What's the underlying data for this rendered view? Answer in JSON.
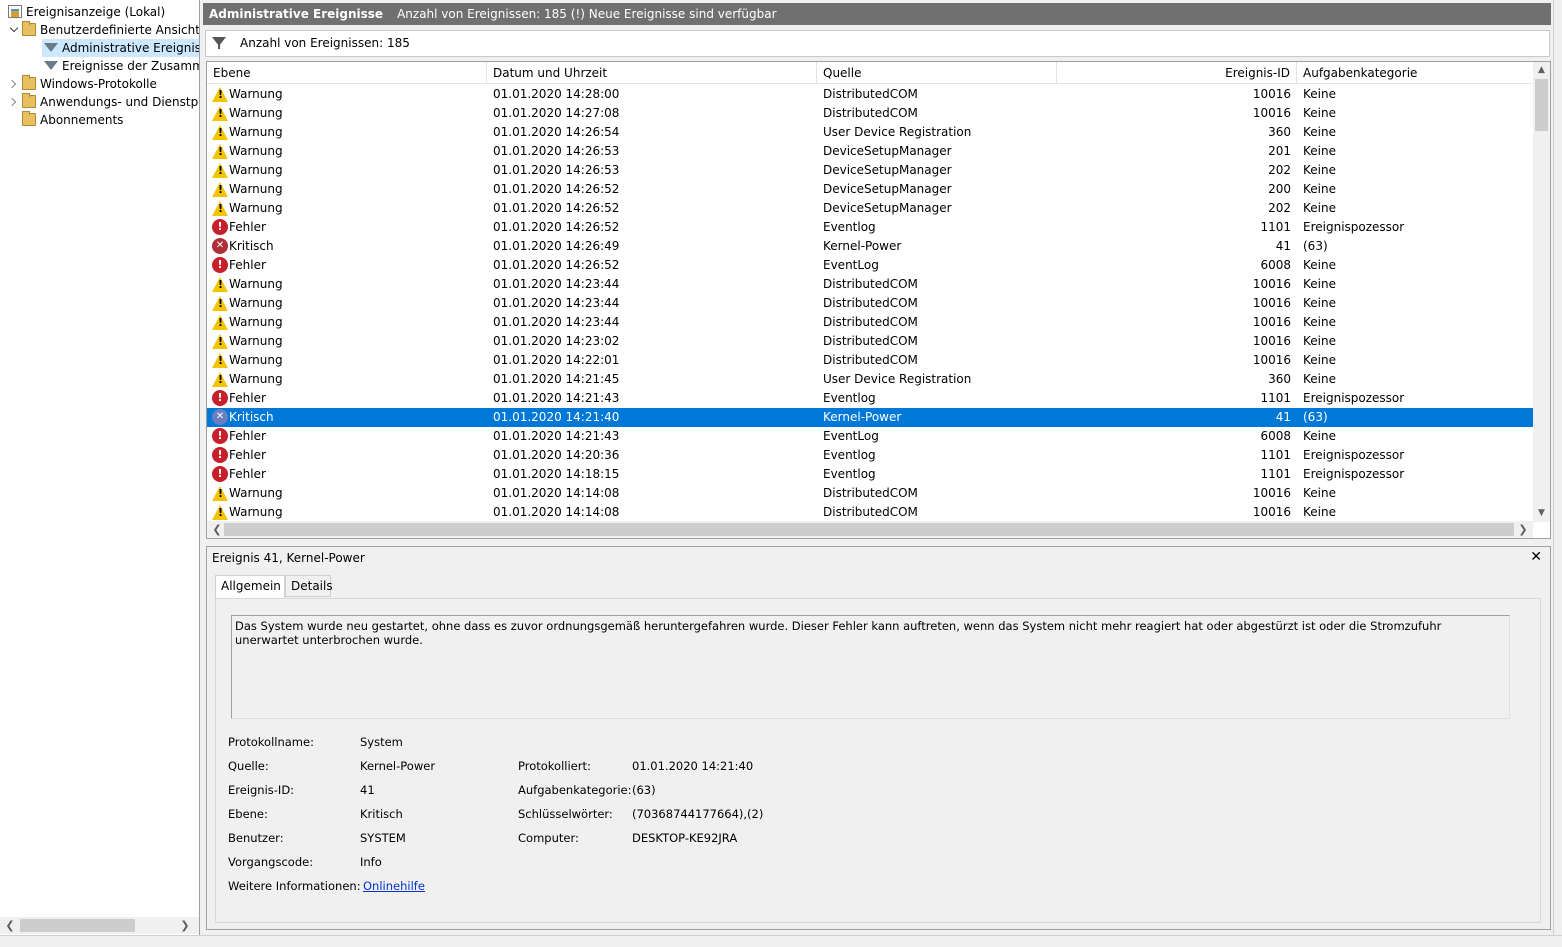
{
  "tree": {
    "items": [
      {
        "label": "Ereignisanzeige (Lokal)",
        "icon": "event-viewer-icon"
      },
      {
        "label": "Benutzerdefinierte Ansichten",
        "icon": "folder-icon"
      },
      {
        "label": "Administrative Ereignisse",
        "icon": "filter-icon"
      },
      {
        "label": "Ereignisse der Zusammenfassung",
        "icon": "filter-icon"
      },
      {
        "label": "Windows-Protokolle",
        "icon": "folder-icon"
      },
      {
        "label": "Anwendungs- und Dienstprotokolle",
        "icon": "folder-icon"
      },
      {
        "label": "Abonnements",
        "icon": "folder-icon"
      }
    ]
  },
  "header": {
    "title": "Administrative Ereignisse",
    "subtitle": "Anzahl von Ereignissen: 185 (!) Neue Ereignisse sind verfügbar"
  },
  "filter": {
    "text": "Anzahl von Ereignissen: 185"
  },
  "grid": {
    "columns": [
      "Ebene",
      "Datum und Uhrzeit",
      "Quelle",
      "Ereignis-ID",
      "Aufgabenkategorie"
    ],
    "rows": [
      {
        "level": "Warnung",
        "type": "warn",
        "date": "01.01.2020 14:28:00",
        "source": "DistributedCOM",
        "id": "10016",
        "cat": "Keine"
      },
      {
        "level": "Warnung",
        "type": "warn",
        "date": "01.01.2020 14:27:08",
        "source": "DistributedCOM",
        "id": "10016",
        "cat": "Keine"
      },
      {
        "level": "Warnung",
        "type": "warn",
        "date": "01.01.2020 14:26:54",
        "source": "User Device Registration",
        "id": "360",
        "cat": "Keine"
      },
      {
        "level": "Warnung",
        "type": "warn",
        "date": "01.01.2020 14:26:53",
        "source": "DeviceSetupManager",
        "id": "201",
        "cat": "Keine"
      },
      {
        "level": "Warnung",
        "type": "warn",
        "date": "01.01.2020 14:26:53",
        "source": "DeviceSetupManager",
        "id": "202",
        "cat": "Keine"
      },
      {
        "level": "Warnung",
        "type": "warn",
        "date": "01.01.2020 14:26:52",
        "source": "DeviceSetupManager",
        "id": "200",
        "cat": "Keine"
      },
      {
        "level": "Warnung",
        "type": "warn",
        "date": "01.01.2020 14:26:52",
        "source": "DeviceSetupManager",
        "id": "202",
        "cat": "Keine"
      },
      {
        "level": "Fehler",
        "type": "err",
        "date": "01.01.2020 14:26:52",
        "source": "Eventlog",
        "id": "1101",
        "cat": "Ereignispozessor"
      },
      {
        "level": "Kritisch",
        "type": "crit",
        "date": "01.01.2020 14:26:49",
        "source": "Kernel-Power",
        "id": "41",
        "cat": "(63)"
      },
      {
        "level": "Fehler",
        "type": "err",
        "date": "01.01.2020 14:26:52",
        "source": "EventLog",
        "id": "6008",
        "cat": "Keine"
      },
      {
        "level": "Warnung",
        "type": "warn",
        "date": "01.01.2020 14:23:44",
        "source": "DistributedCOM",
        "id": "10016",
        "cat": "Keine"
      },
      {
        "level": "Warnung",
        "type": "warn",
        "date": "01.01.2020 14:23:44",
        "source": "DistributedCOM",
        "id": "10016",
        "cat": "Keine"
      },
      {
        "level": "Warnung",
        "type": "warn",
        "date": "01.01.2020 14:23:44",
        "source": "DistributedCOM",
        "id": "10016",
        "cat": "Keine"
      },
      {
        "level": "Warnung",
        "type": "warn",
        "date": "01.01.2020 14:23:02",
        "source": "DistributedCOM",
        "id": "10016",
        "cat": "Keine"
      },
      {
        "level": "Warnung",
        "type": "warn",
        "date": "01.01.2020 14:22:01",
        "source": "DistributedCOM",
        "id": "10016",
        "cat": "Keine"
      },
      {
        "level": "Warnung",
        "type": "warn",
        "date": "01.01.2020 14:21:45",
        "source": "User Device Registration",
        "id": "360",
        "cat": "Keine"
      },
      {
        "level": "Fehler",
        "type": "err",
        "date": "01.01.2020 14:21:43",
        "source": "Eventlog",
        "id": "1101",
        "cat": "Ereignispozessor"
      },
      {
        "level": "Kritisch",
        "type": "crit",
        "date": "01.01.2020 14:21:40",
        "source": "Kernel-Power",
        "id": "41",
        "cat": "(63)",
        "selected": true
      },
      {
        "level": "Fehler",
        "type": "err",
        "date": "01.01.2020 14:21:43",
        "source": "EventLog",
        "id": "6008",
        "cat": "Keine"
      },
      {
        "level": "Fehler",
        "type": "err",
        "date": "01.01.2020 14:20:36",
        "source": "Eventlog",
        "id": "1101",
        "cat": "Ereignispozessor"
      },
      {
        "level": "Fehler",
        "type": "err",
        "date": "01.01.2020 14:18:15",
        "source": "Eventlog",
        "id": "1101",
        "cat": "Ereignispozessor"
      },
      {
        "level": "Warnung",
        "type": "warn",
        "date": "01.01.2020 14:14:08",
        "source": "DistributedCOM",
        "id": "10016",
        "cat": "Keine"
      },
      {
        "level": "Warnung",
        "type": "warn",
        "date": "01.01.2020 14:14:08",
        "source": "DistributedCOM",
        "id": "10016",
        "cat": "Keine"
      }
    ]
  },
  "detail": {
    "title": "Ereignis 41, Kernel-Power",
    "close": "✕",
    "tabs": [
      "Allgemein",
      "Details"
    ],
    "description": "Das System wurde neu gestartet, ohne dass es zuvor ordnungsgemäß heruntergefahren wurde. Dieser Fehler kann auftreten, wenn das System nicht mehr reagiert hat oder abgestürzt ist oder die Stromzufuhr unerwartet unterbrochen wurde.",
    "fields": {
      "protokollname_label": "Protokollname:",
      "protokollname": "System",
      "quelle_label": "Quelle:",
      "quelle": "Kernel-Power",
      "protokolliert_label": "Protokolliert:",
      "protokolliert": "01.01.2020 14:21:40",
      "id_label": "Ereignis-ID:",
      "id": "41",
      "aufgabe_label": "Aufgabenkategorie:",
      "aufgabe": "(63)",
      "ebene_label": "Ebene:",
      "ebene": "Kritisch",
      "schluessel_label": "Schlüsselwörter:",
      "schluessel": "(70368744177664),(2)",
      "benutzer_label": "Benutzer:",
      "benutzer": "SYSTEM",
      "computer_label": "Computer:",
      "computer": "DESKTOP-KE92JRA",
      "vorgang_label": "Vorgangscode:",
      "vorgang": "Info",
      "weitere_label": "Weitere Informationen:",
      "weitere": "Onlinehilfe"
    }
  }
}
